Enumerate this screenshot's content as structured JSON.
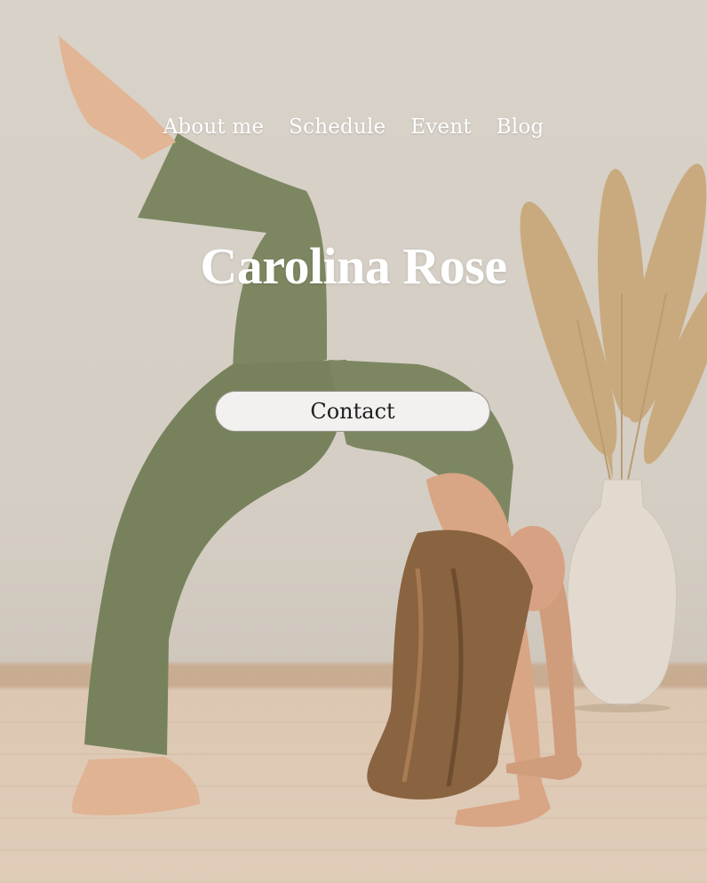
{
  "nav": {
    "items": [
      {
        "label": "About me"
      },
      {
        "label": "Schedule"
      },
      {
        "label": "Event"
      },
      {
        "label": "Blog"
      }
    ]
  },
  "hero": {
    "title": "Carolina Rose",
    "cta_label": "Contact"
  },
  "colors": {
    "wall": "#d6cfc5",
    "floor": "#dfcbb6",
    "outfit": "#7b8660",
    "vase": "#e4dbd0",
    "pampas": "#c8a878",
    "button_bg": "#f2f1f0"
  }
}
